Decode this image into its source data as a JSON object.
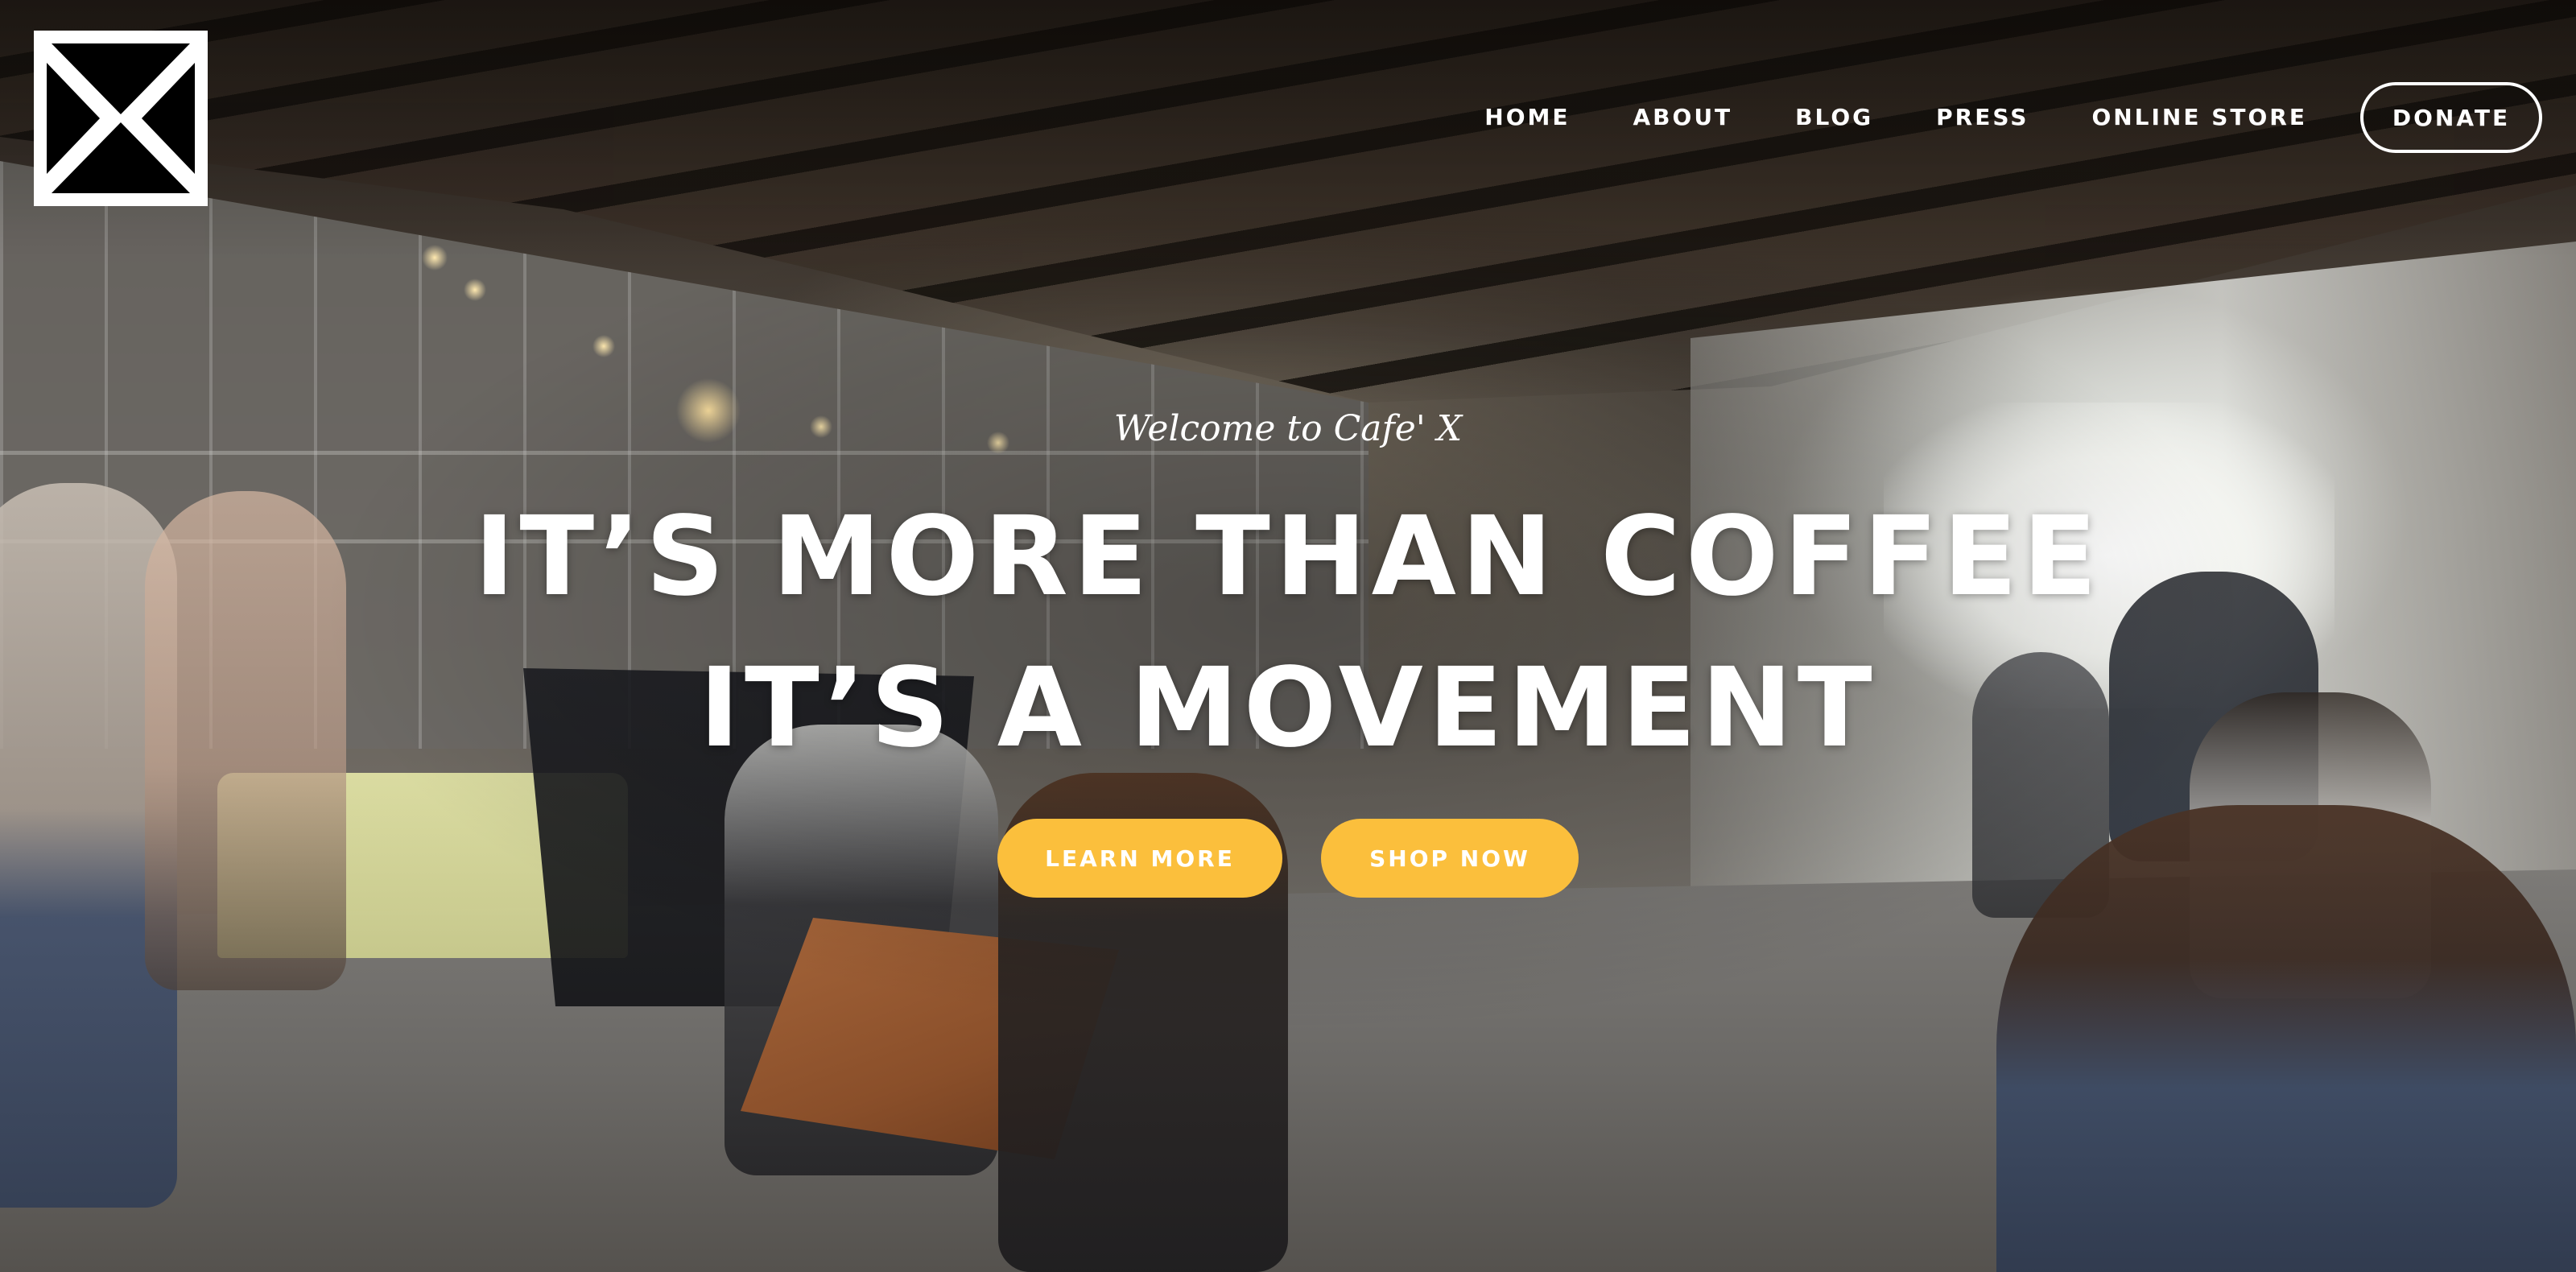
{
  "brand": {
    "logo_icon": "hourglass-x-logo-icon",
    "logo_bg_color": "#ffffff",
    "logo_fg_color": "#000000"
  },
  "nav": {
    "items": [
      {
        "label": "HOME"
      },
      {
        "label": "ABOUT"
      },
      {
        "label": "BLOG"
      },
      {
        "label": "PRESS"
      },
      {
        "label": "ONLINE STORE"
      }
    ],
    "donate_label": "DONATE"
  },
  "hero": {
    "welcome": "Welcome to Cafe' X",
    "headline_line1": "IT’S MORE THAN COFFEE",
    "headline_line2": "IT’S A MOVEMENT",
    "learn_more_label": "LEARN MORE",
    "shop_now_label": "SHOP NOW",
    "button_color": "#fbbf3c",
    "text_color": "#ffffff"
  }
}
